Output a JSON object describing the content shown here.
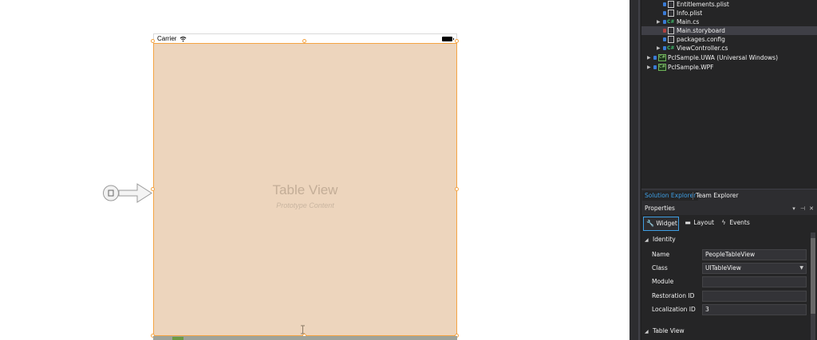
{
  "storyboard": {
    "status_bar": {
      "carrier": "Carrier"
    },
    "table_view": {
      "title": "Table View",
      "subtitle": "Prototype Content"
    }
  },
  "solution_explorer": {
    "items": [
      {
        "label": "Entitlements.plist",
        "icon": "plist-file-icon"
      },
      {
        "label": "Info.plist",
        "icon": "plist-file-icon"
      },
      {
        "label": "Main.cs",
        "icon": "csharp-file-icon"
      },
      {
        "label": "Main.storyboard",
        "icon": "storyboard-file-icon",
        "selected": true
      },
      {
        "label": "packages.config",
        "icon": "config-file-icon"
      },
      {
        "label": "ViewController.cs",
        "icon": "csharp-file-icon"
      },
      {
        "label": "PclSample.UWA (Universal Windows)",
        "icon": "project-icon"
      },
      {
        "label": "PclSample.WPF",
        "icon": "project-icon"
      }
    ],
    "tabs": [
      "Solution Explorer",
      "Team Explorer"
    ],
    "active_tab": "Solution Explorer"
  },
  "properties": {
    "title": "Properties",
    "header_buttons": [
      "▾",
      "⊣",
      "✕"
    ],
    "tabs": [
      {
        "label": "Widget",
        "icon": "wrench-icon"
      },
      {
        "label": "Layout",
        "icon": "layout-icon"
      },
      {
        "label": "Events",
        "icon": "lightning-icon"
      }
    ],
    "identity_section": "Identity",
    "fields": [
      {
        "label": "Name",
        "value": "PeopleTableView"
      },
      {
        "label": "Class",
        "value": "UITableView",
        "dropdown": true
      },
      {
        "label": "Module",
        "value": ""
      },
      {
        "label": "Restoration ID",
        "value": ""
      },
      {
        "label": "Localization ID",
        "value": "3"
      }
    ],
    "table_view_section": "Table View"
  },
  "colors": {
    "table_view_fill": "#edd5bd",
    "selection_orange": "#f5a443",
    "ide_background": "#252526",
    "accent_blue": "#3e9fe5"
  }
}
